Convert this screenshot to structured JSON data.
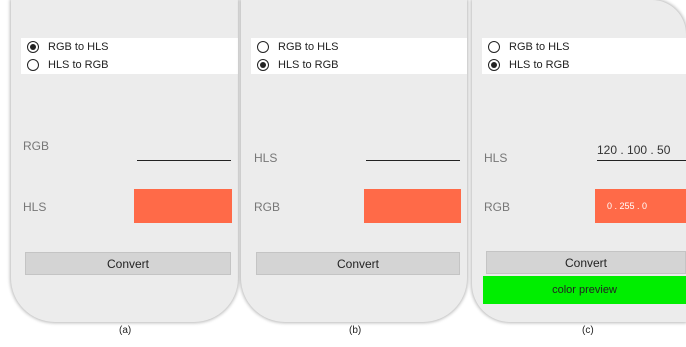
{
  "panels": [
    {
      "options": [
        {
          "label": "RGB to HLS",
          "selected": true
        },
        {
          "label": "HLS to RGB",
          "selected": false
        }
      ],
      "input_label": "RGB",
      "input_value": "",
      "result_label": "HLS",
      "result_value": "",
      "convert_label": "Convert",
      "caption": "(a)"
    },
    {
      "options": [
        {
          "label": "RGB to HLS",
          "selected": false
        },
        {
          "label": "HLS to RGB",
          "selected": true
        }
      ],
      "input_label": "HLS",
      "input_value": "",
      "result_label": "RGB",
      "result_value": "",
      "convert_label": "Convert",
      "caption": "(b)"
    },
    {
      "options": [
        {
          "label": "RGB to HLS",
          "selected": false
        },
        {
          "label": "HLS to RGB",
          "selected": true
        }
      ],
      "input_label": "HLS",
      "input_value": "120 . 100 . 50",
      "result_label": "RGB",
      "result_value": "0 . 255 . 0",
      "convert_label": "Convert",
      "preview_label": "color preview",
      "preview_color": "#00ee00",
      "caption": "(c)"
    }
  ],
  "colors": {
    "result_box": "#ff6a48",
    "preview": "#00ee00"
  }
}
